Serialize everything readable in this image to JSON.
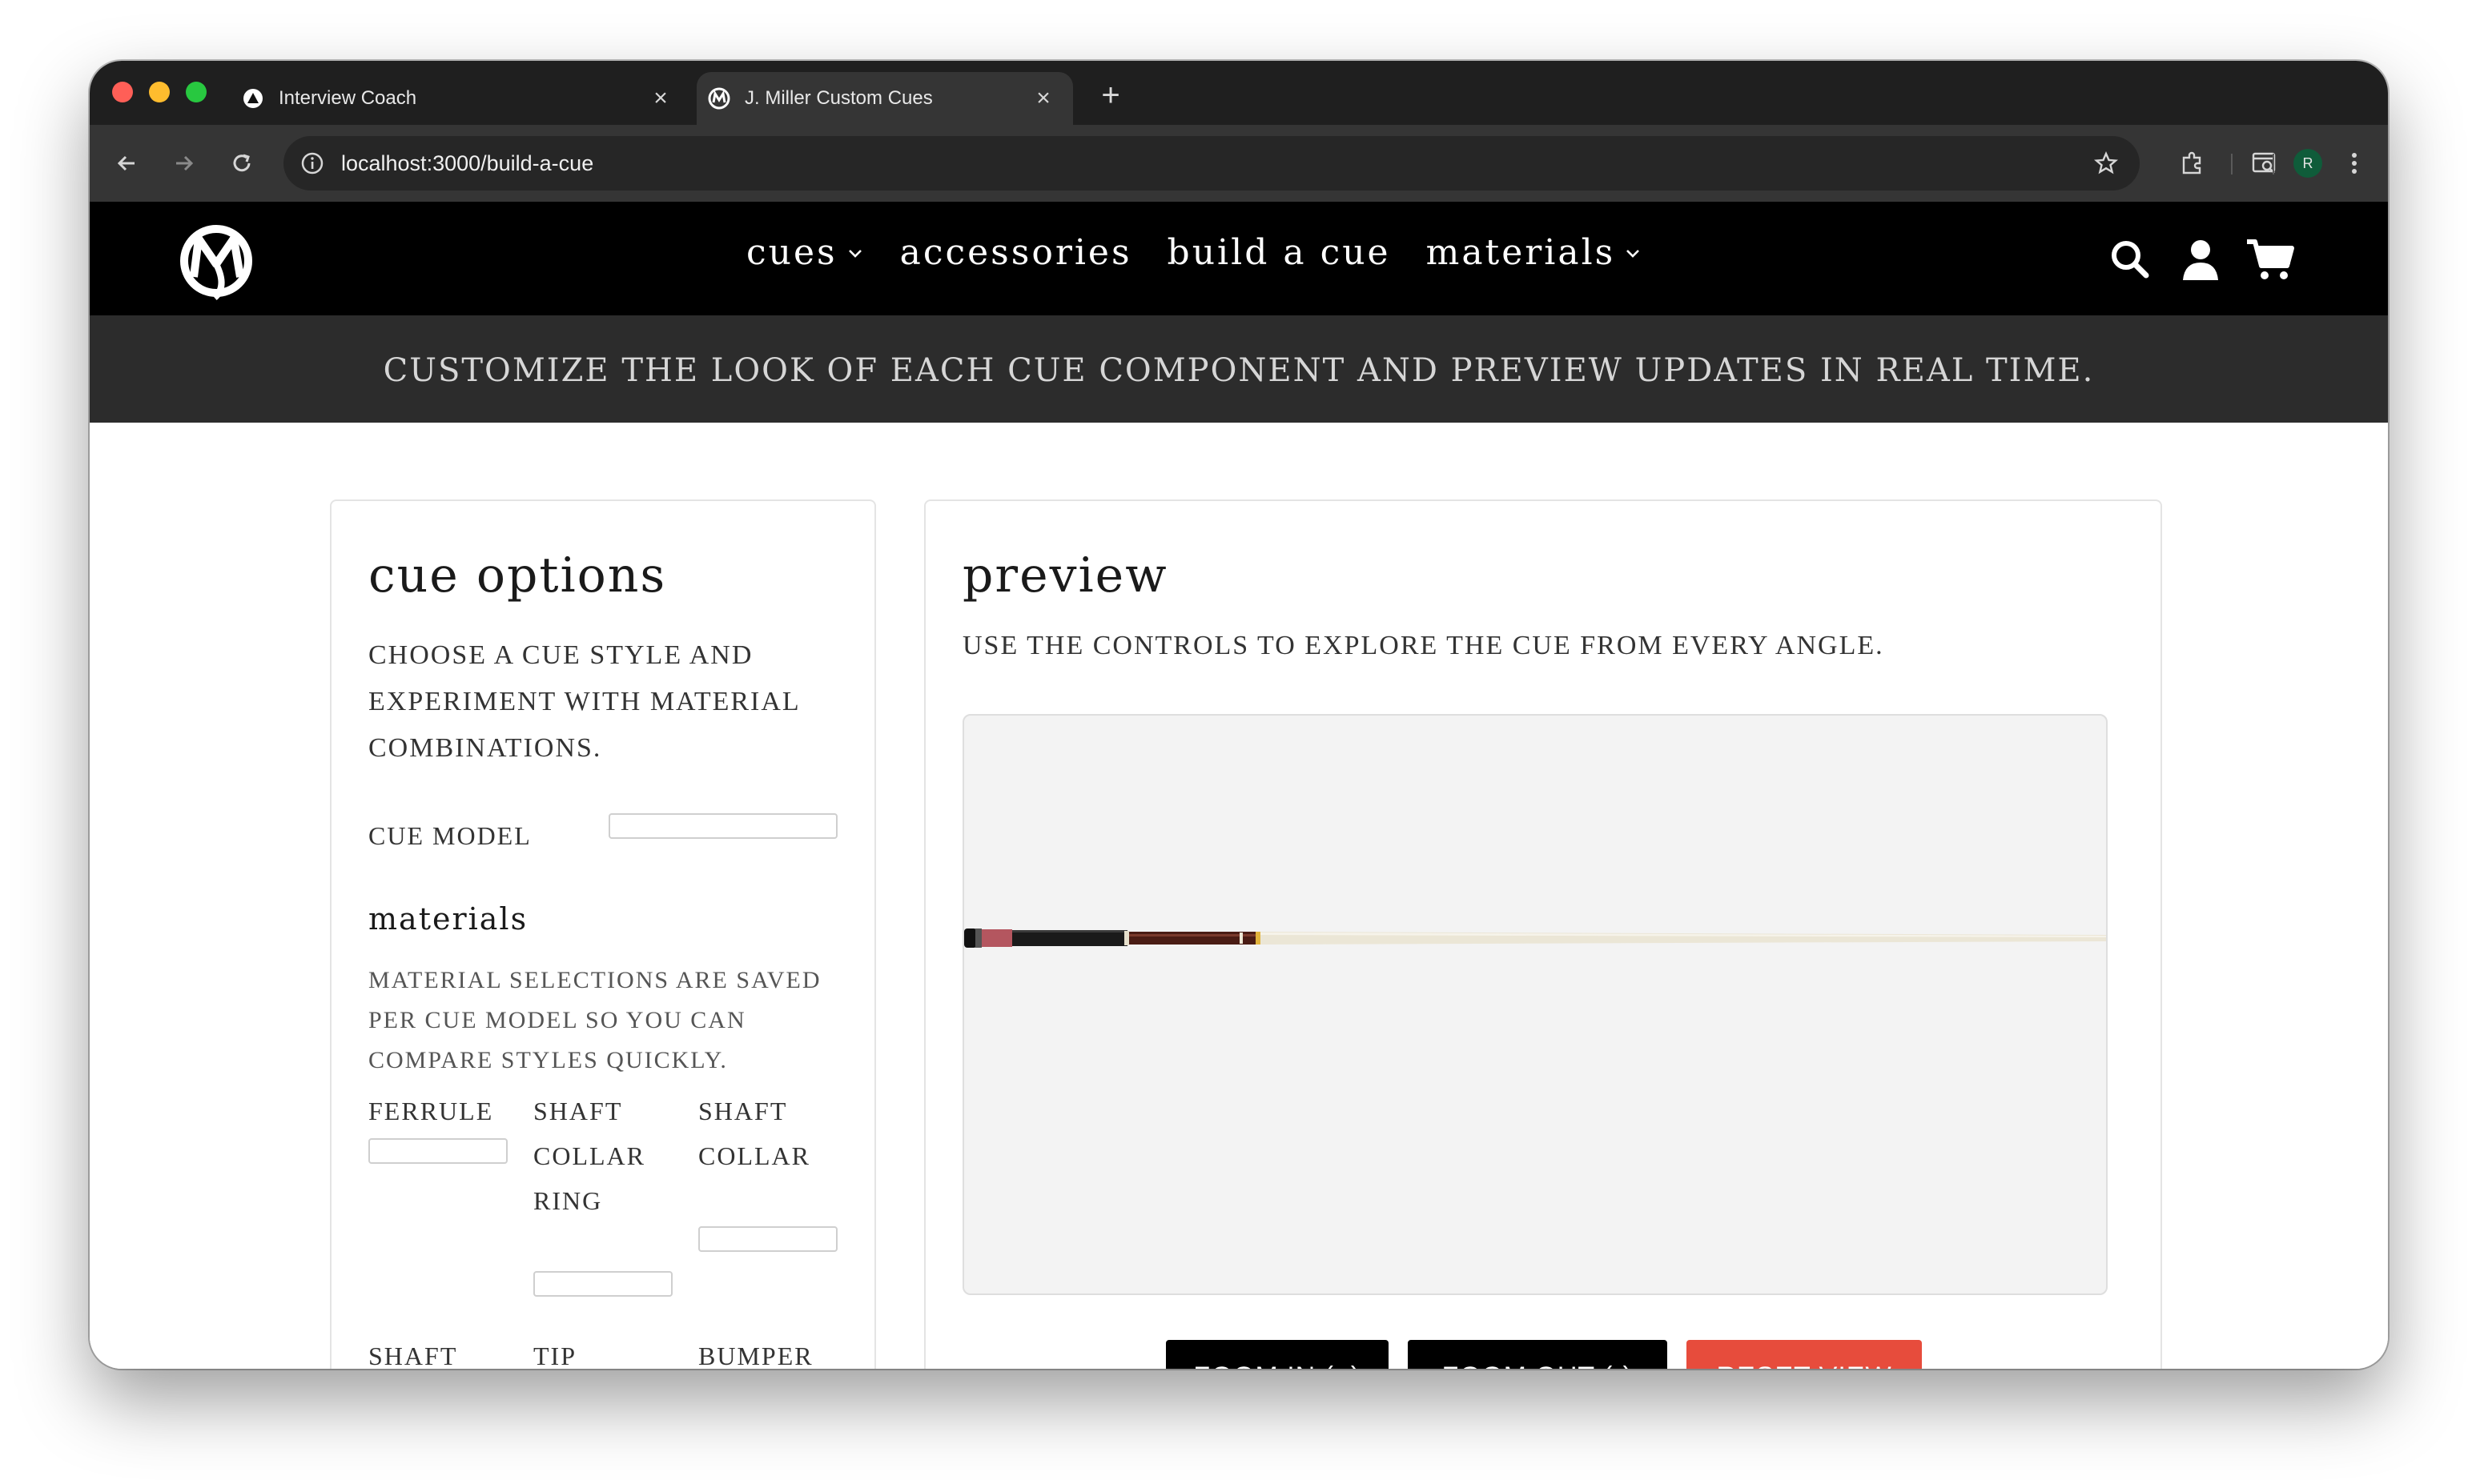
{
  "browser": {
    "tabs": [
      {
        "title": "Interview Coach",
        "active": false,
        "icon": "triangle-logo-icon"
      },
      {
        "title": "J. Miller Custom Cues",
        "active": true,
        "icon": "jm-logo-icon"
      }
    ],
    "url": "localhost:3000/build-a-cue",
    "profile_initial": "R"
  },
  "site": {
    "nav": {
      "items": [
        {
          "label": "cues",
          "dropdown": true
        },
        {
          "label": "accessories",
          "dropdown": false
        },
        {
          "label": "build a cue",
          "dropdown": false
        },
        {
          "label": "materials",
          "dropdown": true
        }
      ]
    },
    "hero_subtitle": "CUSTOMIZE THE LOOK OF EACH CUE COMPONENT AND PREVIEW UPDATES IN REAL TIME."
  },
  "options": {
    "title": "cue options",
    "description": "Choose a cue style and experiment with material combinations.",
    "cue_model_label": "Cue model",
    "materials_title": "materials",
    "materials_description": "Material selections are saved per cue model so you can compare styles quickly.",
    "fields": {
      "ferrule": "Ferrule",
      "shaft_collar_ring": "Shaft collar ring",
      "shaft_collar": "Shaft collar",
      "shaft": "Shaft",
      "tip": "Tip",
      "bumper": "Bumper"
    }
  },
  "preview": {
    "title": "preview",
    "description": "Use the controls to explore the cue from every angle.",
    "buttons": {
      "zoom_in": "ZOOM IN (+)",
      "zoom_out": "ZOOM OUT (-)",
      "reset": "RESET VIEW"
    }
  },
  "colors": {
    "nav_bg": "#000000",
    "accent_red": "#e74c3c",
    "button_black": "#000000"
  }
}
